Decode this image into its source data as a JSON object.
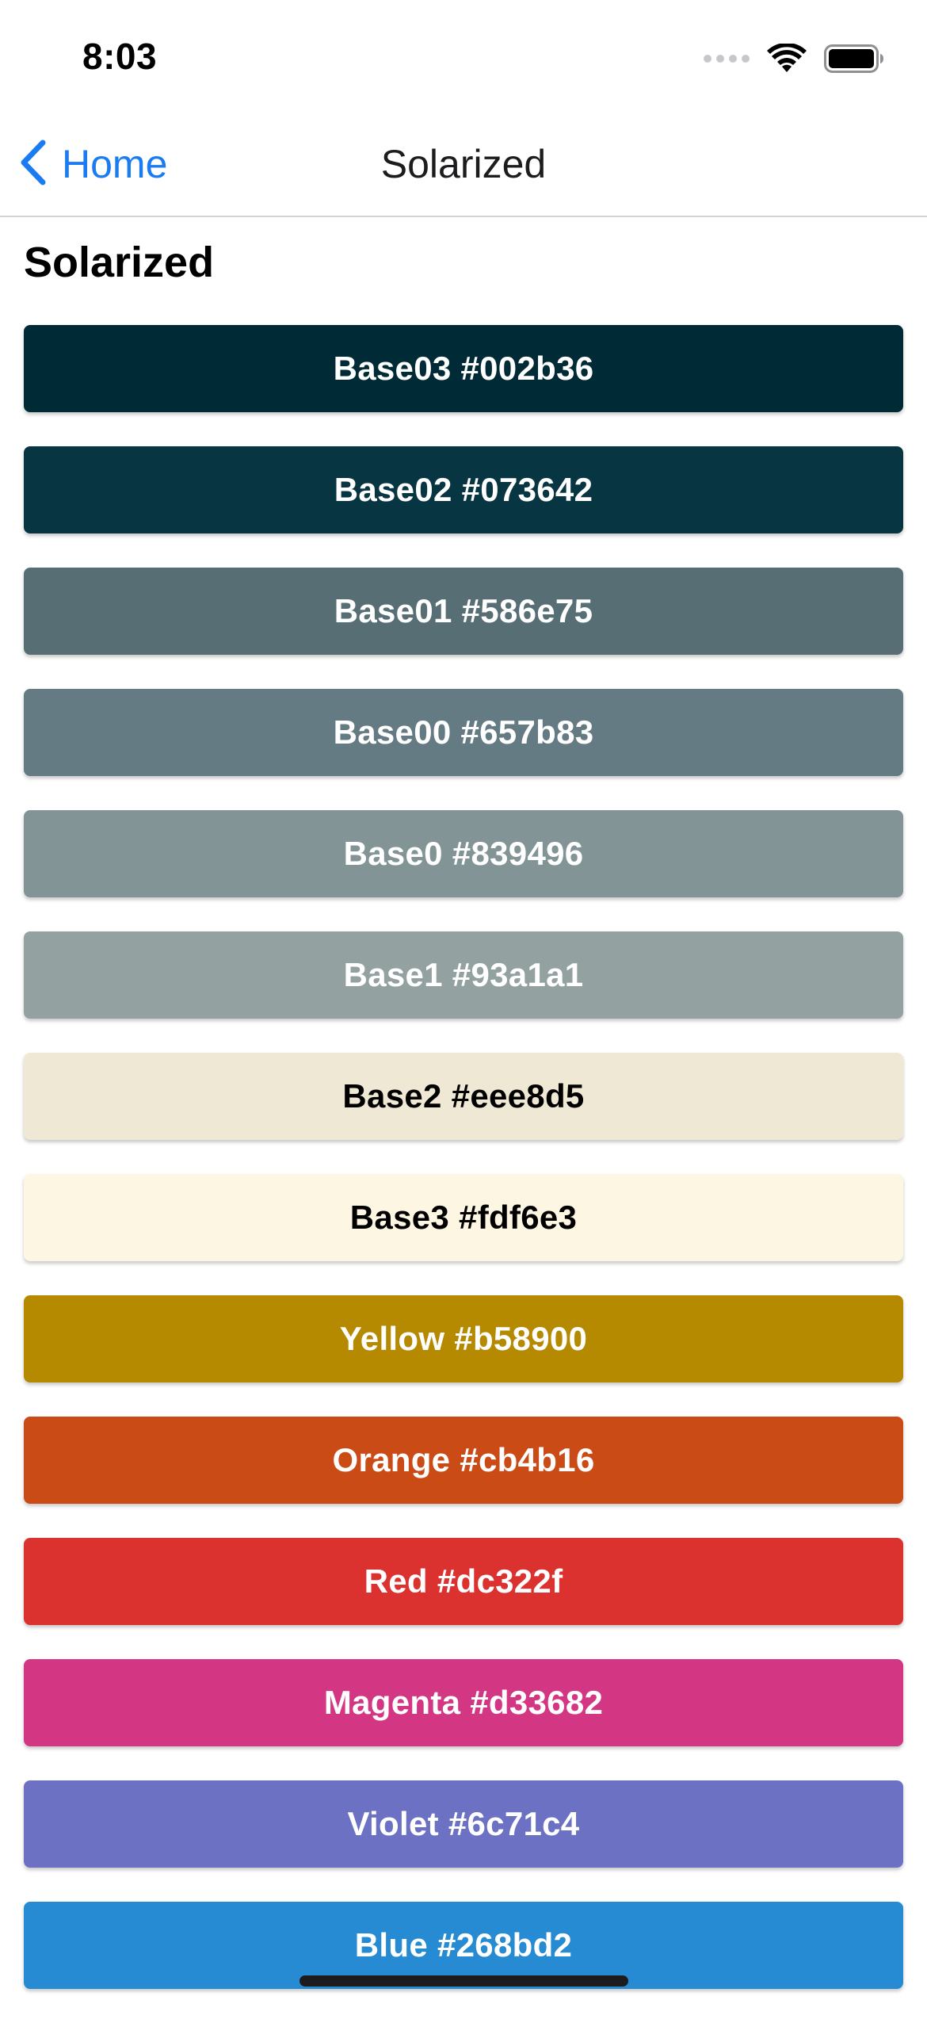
{
  "status_bar": {
    "time": "8:03"
  },
  "nav": {
    "back_label": "Home",
    "title": "Solarized"
  },
  "section_title": "Solarized",
  "swatches": [
    {
      "label": "Base03 #002b36",
      "bg": "#002b36",
      "fg": "#ffffff"
    },
    {
      "label": "Base02 #073642",
      "bg": "#073642",
      "fg": "#ffffff"
    },
    {
      "label": "Base01 #586e75",
      "bg": "#586e75",
      "fg": "#ffffff"
    },
    {
      "label": "Base00 #657b83",
      "bg": "#657b83",
      "fg": "#ffffff"
    },
    {
      "label": "Base0 #839496",
      "bg": "#839496",
      "fg": "#ffffff"
    },
    {
      "label": "Base1 #93a1a1",
      "bg": "#93a1a1",
      "fg": "#ffffff"
    },
    {
      "label": "Base2 #eee8d5",
      "bg": "#eee8d5",
      "fg": "#000000"
    },
    {
      "label": "Base3 #fdf6e3",
      "bg": "#fdf6e3",
      "fg": "#000000"
    },
    {
      "label": "Yellow #b58900",
      "bg": "#b58900",
      "fg": "#ffffff"
    },
    {
      "label": "Orange #cb4b16",
      "bg": "#cb4b16",
      "fg": "#ffffff"
    },
    {
      "label": "Red #dc322f",
      "bg": "#dc322f",
      "fg": "#ffffff"
    },
    {
      "label": "Magenta #d33682",
      "bg": "#d33682",
      "fg": "#ffffff"
    },
    {
      "label": "Violet #6c71c4",
      "bg": "#6c71c4",
      "fg": "#ffffff"
    },
    {
      "label": "Blue #268bd2",
      "bg": "#268bd2",
      "fg": "#ffffff"
    }
  ],
  "colors": {
    "accent": "#1a7bf2"
  }
}
